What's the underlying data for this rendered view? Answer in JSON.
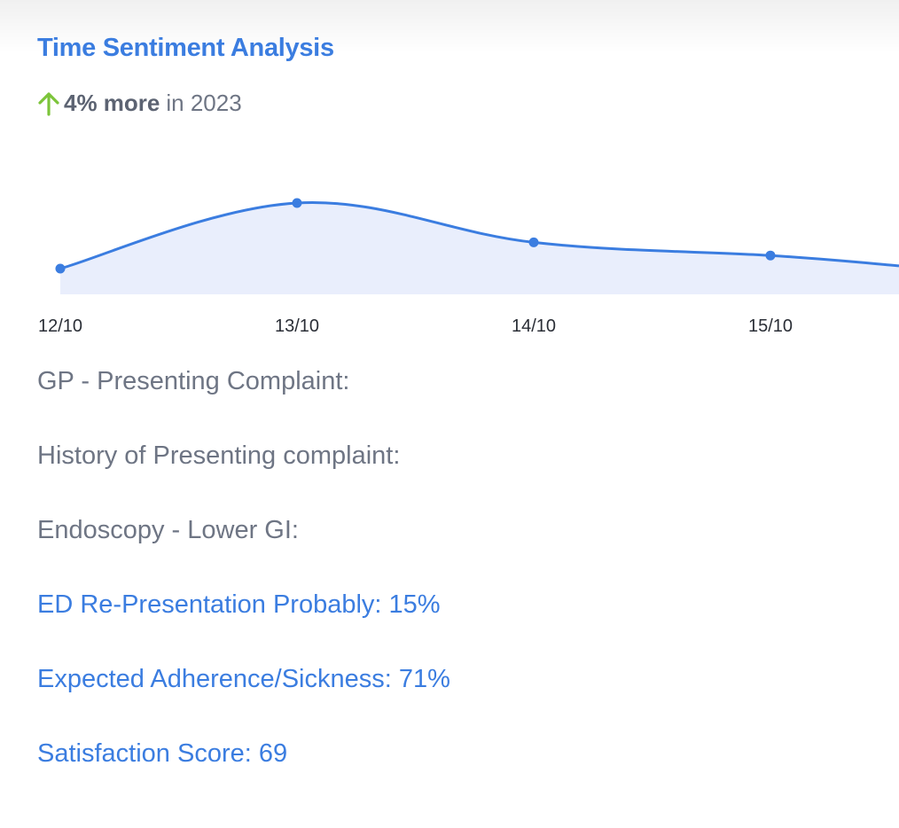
{
  "card": {
    "title": "Time Sentiment Analysis",
    "trend": {
      "icon": "arrow-up-icon",
      "icon_color": "#7cc43a",
      "highlight": "4% more",
      "suffix": "in 2023"
    }
  },
  "chart_data": {
    "type": "area",
    "categories": [
      "12/10",
      "13/10",
      "14/10",
      "15/10",
      ""
    ],
    "values": [
      30,
      100,
      58,
      44,
      33
    ],
    "line_color": "#3b7de0",
    "fill_color": "#e9eefc",
    "grid": false,
    "legend": "none"
  },
  "details": [
    {
      "label": "GP - Presenting Complaint:",
      "style": "muted"
    },
    {
      "label": "History of Presenting complaint:",
      "style": "muted"
    },
    {
      "label": "Endoscopy - Lower GI:",
      "style": "muted"
    },
    {
      "label": "ED Re-Presentation Probably: 15%",
      "style": "accent"
    },
    {
      "label": "Expected Adherence/Sickness: 71%",
      "style": "accent"
    },
    {
      "label": "Satisfaction Score: 69",
      "style": "accent"
    }
  ],
  "colors": {
    "accent": "#3b7de0",
    "muted_text": "#6e7584",
    "positive": "#7cc43a"
  }
}
